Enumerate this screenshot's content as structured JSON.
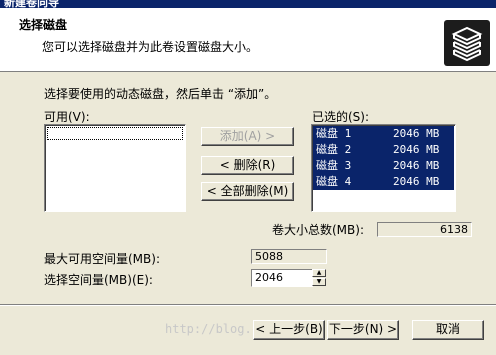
{
  "window": {
    "title": "新建卷向导"
  },
  "header": {
    "title": "选择磁盘",
    "subtitle": "您可以选择磁盘并为此卷设置磁盘大小。",
    "icon": "disk-stack-icon"
  },
  "instruction": "选择要使用的动态磁盘，然后单击 “添加”。",
  "available": {
    "label": "可用(V):",
    "items": []
  },
  "selected": {
    "label": "已选的(S):",
    "items": [
      {
        "name": "磁盘 1",
        "size": "2046 MB"
      },
      {
        "name": "磁盘 2",
        "size": "2046 MB"
      },
      {
        "name": "磁盘 3",
        "size": "2046 MB"
      },
      {
        "name": "磁盘 4",
        "size": "2046 MB"
      }
    ]
  },
  "buttons": {
    "add": "添加(A) >",
    "remove": "< 删除(R)",
    "remove_all": "< 全部删除(M)",
    "back": "< 上一步(B)",
    "next": "下一步(N) >",
    "cancel": "取消"
  },
  "total_size": {
    "label": "卷大小总数(MB):",
    "value": "6138"
  },
  "max_space": {
    "label": "最大可用空间量(MB):",
    "value": "5088"
  },
  "select_space": {
    "label": "选择空间量(MB)(E):",
    "value": "2046"
  },
  "watermark": "http://blog.csdn.net/"
}
